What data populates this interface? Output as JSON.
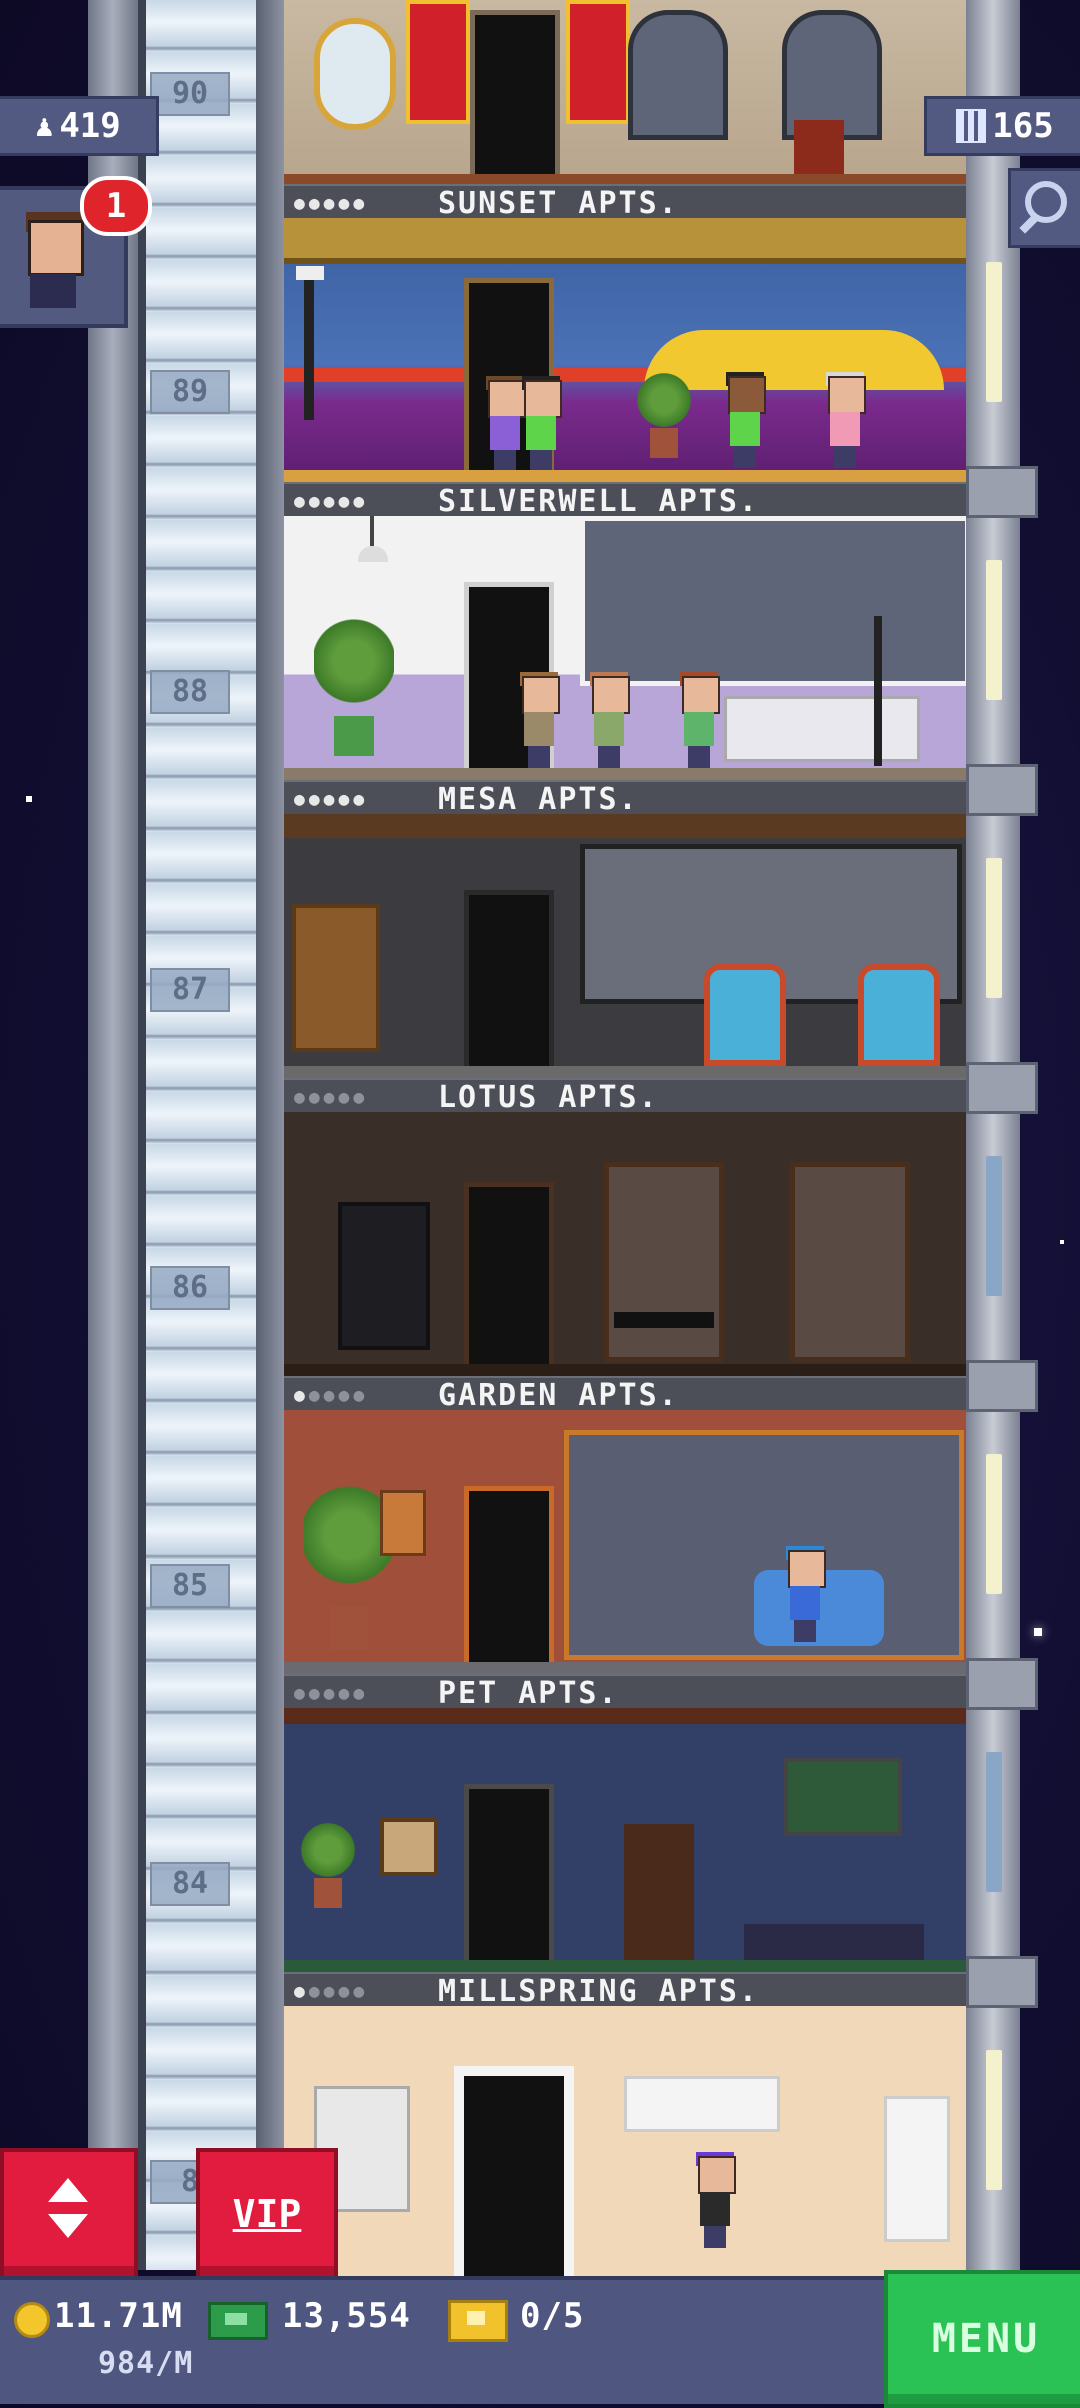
{
  "hud": {
    "population": "419",
    "population_icon": "person-icon",
    "bux_floors": "165",
    "bux_icon": "building-icon",
    "visitor_notifications": "1"
  },
  "floor_numbers": [
    "90",
    "89",
    "88",
    "87",
    "86",
    "85",
    "84",
    "8"
  ],
  "floors": [
    {
      "name": "SUNSET APTS.",
      "stars_filled": 5
    },
    {
      "name": "SILVERWELL APTS.",
      "stars_filled": 5
    },
    {
      "name": "MESA APTS.",
      "stars_filled": 5
    },
    {
      "name": "LOTUS APTS.",
      "stars_filled": 0
    },
    {
      "name": "GARDEN APTS.",
      "stars_filled": 1
    },
    {
      "name": "PET APTS.",
      "stars_filled": 0
    },
    {
      "name": "MILLSPRING APTS.",
      "stars_filled": 1
    }
  ],
  "buttons": {
    "vip_label": "VIP",
    "menu_label": "MENU"
  },
  "bottom_bar": {
    "coins": "11.71M",
    "coin_rate": "984/M",
    "bux": "13,554",
    "tickets": "0/5"
  },
  "colors": {
    "accent_red": "#e21c3e",
    "menu_green": "#2bc255",
    "hud_blue": "#535a82"
  }
}
